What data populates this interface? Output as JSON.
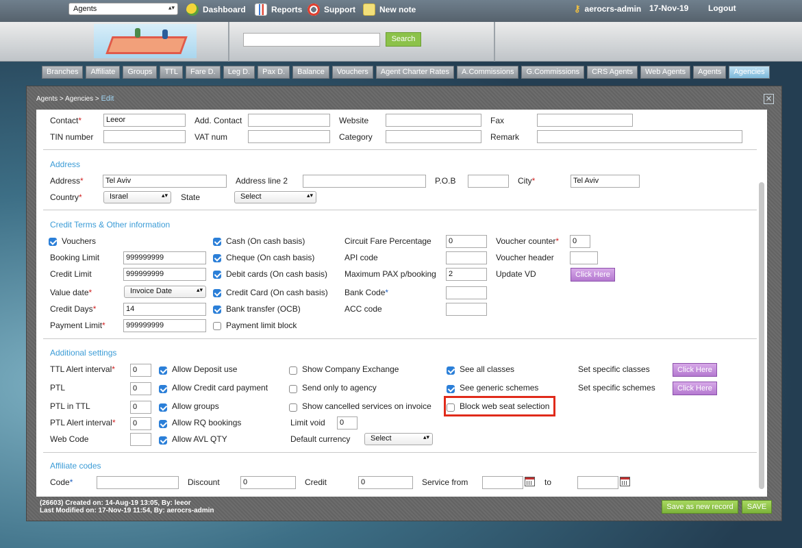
{
  "topbar": {
    "agent_select": "Agents",
    "nav": [
      {
        "label": "Dashboard",
        "icon": "dashboard-pie-icon"
      },
      {
        "label": "Reports",
        "icon": "reports-icon"
      },
      {
        "label": "Support",
        "icon": "lifebuoy-icon"
      },
      {
        "label": "New note",
        "icon": "note-icon"
      }
    ],
    "user": "aerocrs-admin",
    "date": "17-Nov-19",
    "logout": "Logout"
  },
  "search": {
    "button": "Search"
  },
  "tabs": [
    "Branches",
    "Affiliate",
    "Groups",
    "TTL",
    "Fare D.",
    "Leg D.",
    "Pax D.",
    "Balance",
    "Vouchers",
    "Agent Charter Rates",
    "A.Commissions",
    "G.Commissions",
    "CRS Agents",
    "Web Agents",
    "Agents",
    "Agencies"
  ],
  "active_tab": "Agencies",
  "breadcrumb": {
    "path": "Agents > Agencies >",
    "current": "Edit"
  },
  "contact": {
    "contact_label": "Contact",
    "contact_value": "Leeor",
    "add_contact_label": "Add. Contact",
    "website_label": "Website",
    "fax_label": "Fax",
    "tin_label": "TIN number",
    "vat_label": "VAT num",
    "category_label": "Category",
    "remark_label": "Remark"
  },
  "address": {
    "section": "Address",
    "address_label": "Address",
    "address_value": "Tel Aviv",
    "address2_label": "Address line 2",
    "pob_label": "P.O.B",
    "city_label": "City",
    "city_value": "Tel Aviv",
    "country_label": "Country",
    "country_value": "Israel",
    "state_label": "State",
    "state_value": "Select"
  },
  "credit": {
    "section": "Credit Terms & Other information",
    "vouchers": "Vouchers",
    "booking_limit_label": "Booking Limit",
    "booking_limit": "999999999",
    "credit_limit_label": "Credit Limit",
    "credit_limit": "999999999",
    "value_date_label": "Value date",
    "value_date": "Invoice Date",
    "credit_days_label": "Credit Days",
    "credit_days": "14",
    "payment_limit_label": "Payment Limit",
    "payment_limit": "999999999",
    "cash": "Cash (On cash basis)",
    "cheque": "Cheque (On cash basis)",
    "debit": "Debit cards (On cash basis)",
    "credit_card": "Credit Card (On cash basis)",
    "bank_transfer": "Bank transfer (OCB)",
    "payment_block": "Payment limit block",
    "circuit_label": "Circuit Fare Percentage",
    "circuit": "0",
    "api_label": "API code",
    "maxpax_label": "Maximum PAX p/booking",
    "maxpax": "2",
    "bank_code_label": "Bank Code",
    "acc_label": "ACC code",
    "voucher_counter_label": "Voucher counter",
    "voucher_counter": "0",
    "voucher_header_label": "Voucher header",
    "update_vd_label": "Update VD",
    "click_here": "Click Here"
  },
  "additional": {
    "section": "Additional settings",
    "ttl_alert_label": "TTL Alert interval",
    "ttl_alert": "0",
    "ptl_label": "PTL",
    "ptl": "0",
    "ptl_ttl_label": "PTL in TTL",
    "ptl_ttl": "0",
    "ptl_alert_label": "PTL Alert interval",
    "ptl_alert": "0",
    "web_code_label": "Web Code",
    "allow_deposit": "Allow Deposit use",
    "allow_cc": "Allow Credit card payment",
    "allow_groups": "Allow groups",
    "allow_rq": "Allow RQ bookings",
    "allow_avl": "Allow AVL QTY",
    "show_company": "Show Company Exchange",
    "send_agency": "Send only to agency",
    "show_cancelled": "Show cancelled services on invoice",
    "limit_void_label": "Limit void",
    "limit_void": "0",
    "default_currency_label": "Default currency",
    "default_currency": "Select",
    "see_all": "See all classes",
    "see_generic": "See generic schemes",
    "block_web": "Block web seat selection",
    "set_classes": "Set specific classes",
    "set_schemes": "Set specific schemes",
    "click_here": "Click Here"
  },
  "affiliate": {
    "section": "Affiliate codes",
    "code_label": "Code",
    "discount_label": "Discount",
    "discount": "0",
    "credit_label": "Credit",
    "credit": "0",
    "service_from_label": "Service from",
    "to_label": "to"
  },
  "footer": {
    "created": "(26603) Created on: 14-Aug-19 13:05, By: leeor",
    "modified": "Last Modified on: 17-Nov-19 11:54, By: aerocrs-admin",
    "save_new": "Save as new record",
    "save": "SAVE"
  },
  "colors": {
    "accent": "#3a9bd6",
    "highlight": "#e02a1a",
    "green_button": "#8cc24a",
    "purple_button": "#b479d0"
  }
}
